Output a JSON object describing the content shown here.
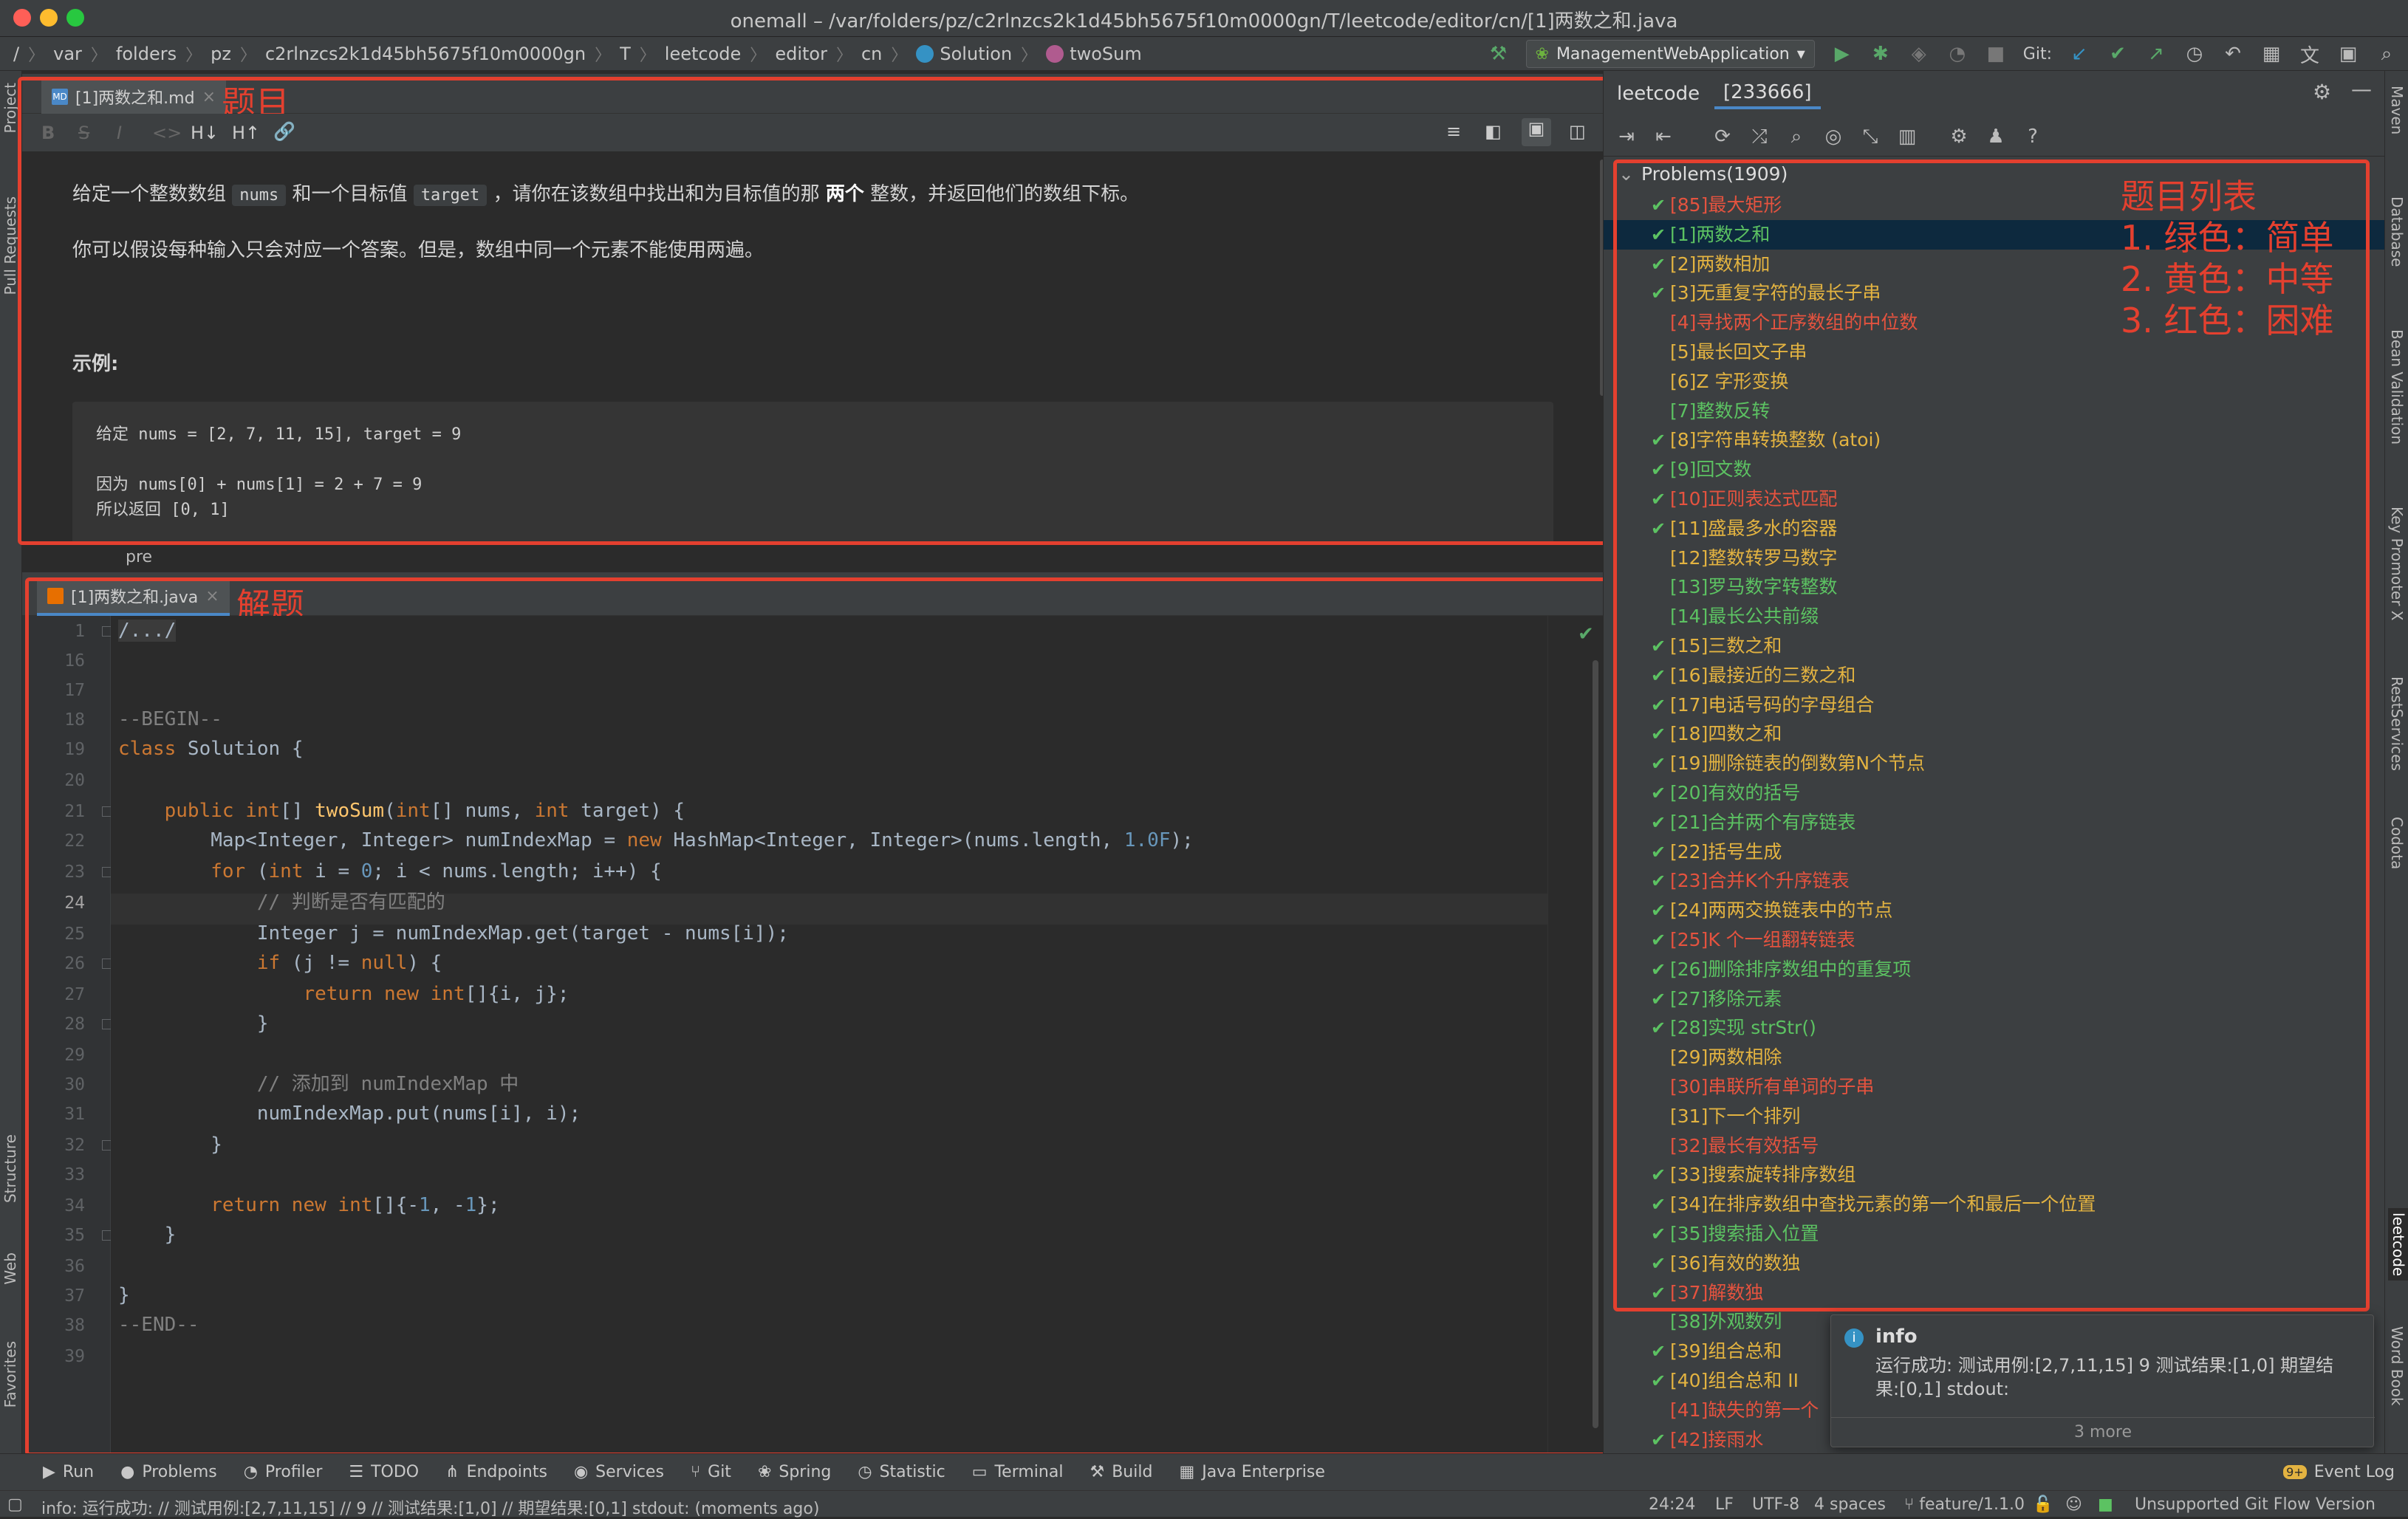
{
  "window": {
    "title": "onemall – /var/folders/pz/c2rlnzcs2k1d45bh5675f10m0000gn/T/leetcode/editor/cn/[1]两数之和.java"
  },
  "breadcrumbs": [
    "/",
    "var",
    "folders",
    "pz",
    "c2rlnzcs2k1d45bh5675f10m0000gn",
    "T",
    "leetcode",
    "editor",
    "cn",
    "Solution",
    "twoSum"
  ],
  "run_config": "ManagementWebApplication",
  "git_label": "Git:",
  "left_stripe": [
    "Project",
    "Pull Requests",
    "Structure",
    "Web",
    "Favorites"
  ],
  "right_stripe": [
    "Maven",
    "Database",
    "Bean Validation",
    "Key Promoter X",
    "RestServices",
    "Codota",
    "leetcode",
    "Word Book"
  ],
  "md_tab": {
    "label": "[1]两数之和.md",
    "annot": "题目"
  },
  "md_toolbar": [
    "B",
    "S",
    "I",
    "<>",
    "H↓",
    "H↑",
    "link-icon"
  ],
  "md": {
    "p1_a": "给定一个整数数组",
    "p1_code1": "nums",
    "p1_b": "和一个目标值",
    "p1_code2": "target",
    "p1_c": "，请你在该数组中找出和为目标值的那",
    "p1_bold": "两个",
    "p1_d": "整数，并返回他们的数组下标。",
    "p2": "你可以假设每种输入只会对应一个答案。但是，数组中同一个元素不能使用两遍。",
    "example_heading": "示例:",
    "pre": [
      "给定 nums = [2, 7, 11, 15], target = 9",
      "",
      "因为 nums[0] + nums[1] = 2 + 7 = 9",
      "所以返回 [0, 1]"
    ],
    "breadcrumb": "pre"
  },
  "java_tab": {
    "label": "[1]两数之和.java",
    "annot": "解题"
  },
  "editor": {
    "current_line": "24",
    "line_numbers": [
      "1",
      "16",
      "17",
      "18",
      "19",
      "20",
      "21",
      "22",
      "23",
      "24",
      "25",
      "26",
      "27",
      "28",
      "29",
      "30",
      "31",
      "32",
      "33",
      "34",
      "35",
      "36",
      "37",
      "38",
      "39"
    ]
  },
  "leetcode": {
    "title": "leetcode",
    "count_tab": "[233666]",
    "root": "Problems(1909)",
    "annot_title": "题目列表",
    "annot_1": "1. 绿色：简单",
    "annot_2": "2. 黄色：中等",
    "annot_3": "3. 红色：困难",
    "problems": [
      {
        "label": "[85]最大矩形",
        "level": "hard",
        "done": true
      },
      {
        "label": "[1]两数之和",
        "level": "easy",
        "done": true
      },
      {
        "label": "[2]两数相加",
        "level": "medium",
        "done": true
      },
      {
        "label": "[3]无重复字符的最长子串",
        "level": "medium",
        "done": true
      },
      {
        "label": "[4]寻找两个正序数组的中位数",
        "level": "hard",
        "done": false
      },
      {
        "label": "[5]最长回文子串",
        "level": "medium",
        "done": false
      },
      {
        "label": "[6]Z 字形变换",
        "level": "medium",
        "done": false
      },
      {
        "label": "[7]整数反转",
        "level": "easy",
        "done": false
      },
      {
        "label": "[8]字符串转换整数 (atoi)",
        "level": "medium",
        "done": true
      },
      {
        "label": "[9]回文数",
        "level": "easy",
        "done": true
      },
      {
        "label": "[10]正则表达式匹配",
        "level": "hard",
        "done": true
      },
      {
        "label": "[11]盛最多水的容器",
        "level": "medium",
        "done": true
      },
      {
        "label": "[12]整数转罗马数字",
        "level": "medium",
        "done": false
      },
      {
        "label": "[13]罗马数字转整数",
        "level": "easy",
        "done": false
      },
      {
        "label": "[14]最长公共前缀",
        "level": "easy",
        "done": false
      },
      {
        "label": "[15]三数之和",
        "level": "medium",
        "done": true
      },
      {
        "label": "[16]最接近的三数之和",
        "level": "medium",
        "done": true
      },
      {
        "label": "[17]电话号码的字母组合",
        "level": "medium",
        "done": true
      },
      {
        "label": "[18]四数之和",
        "level": "medium",
        "done": true
      },
      {
        "label": "[19]删除链表的倒数第N个节点",
        "level": "medium",
        "done": true
      },
      {
        "label": "[20]有效的括号",
        "level": "easy",
        "done": true
      },
      {
        "label": "[21]合并两个有序链表",
        "level": "easy",
        "done": true
      },
      {
        "label": "[22]括号生成",
        "level": "medium",
        "done": true
      },
      {
        "label": "[23]合并K个升序链表",
        "level": "hard",
        "done": true
      },
      {
        "label": "[24]两两交换链表中的节点",
        "level": "medium",
        "done": true
      },
      {
        "label": "[25]K 个一组翻转链表",
        "level": "hard",
        "done": true
      },
      {
        "label": "[26]删除排序数组中的重复项",
        "level": "easy",
        "done": true
      },
      {
        "label": "[27]移除元素",
        "level": "easy",
        "done": true
      },
      {
        "label": "[28]实现 strStr()",
        "level": "easy",
        "done": true
      },
      {
        "label": "[29]两数相除",
        "level": "medium",
        "done": false
      },
      {
        "label": "[30]串联所有单词的子串",
        "level": "hard",
        "done": false
      },
      {
        "label": "[31]下一个排列",
        "level": "medium",
        "done": false
      },
      {
        "label": "[32]最长有效括号",
        "level": "hard",
        "done": false
      },
      {
        "label": "[33]搜索旋转排序数组",
        "level": "medium",
        "done": true
      },
      {
        "label": "[34]在排序数组中查找元素的第一个和最后一个位置",
        "level": "medium",
        "done": true
      },
      {
        "label": "[35]搜索插入位置",
        "level": "easy",
        "done": true
      },
      {
        "label": "[36]有效的数独",
        "level": "medium",
        "done": true
      },
      {
        "label": "[37]解数独",
        "level": "hard",
        "done": true
      },
      {
        "label": "[38]外观数列",
        "level": "easy",
        "done": false
      },
      {
        "label": "[39]组合总和",
        "level": "medium",
        "done": true
      },
      {
        "label": "[40]组合总和 II",
        "level": "medium",
        "done": true
      },
      {
        "label": "[41]缺失的第一个",
        "level": "hard",
        "done": false
      },
      {
        "label": "[42]接雨水",
        "level": "hard",
        "done": true
      }
    ]
  },
  "info_popup": {
    "title": "info",
    "body": "运行成功: 测试用例:[2,7,11,15] 9 测试结果:[1,0] 期望结果:[0,1] stdout:",
    "more": "3 more"
  },
  "toolwindows": [
    "Run",
    "Problems",
    "Profiler",
    "TODO",
    "Endpoints",
    "Services",
    "Git",
    "Spring",
    "Statistic",
    "Terminal",
    "Build",
    "Java Enterprise"
  ],
  "event_log": "Event Log",
  "event_log_badge": "9+",
  "status": {
    "message": "info: 运行成功: // 测试用例:[2,7,11,15] // 9 // 测试结果:[1,0] // 期望结果:[0,1] stdout:  (moments ago)",
    "position": "24:24",
    "line_sep": "LF",
    "encoding": "UTF-8",
    "indent": "4 spaces",
    "branch": "feature/1.1.0",
    "gitflow": "Unsupported Git Flow Version"
  },
  "colors": {
    "easy": "#5cc262",
    "medium": "#e3b341",
    "hard": "#e5533f",
    "annotation": "#e4402f"
  }
}
